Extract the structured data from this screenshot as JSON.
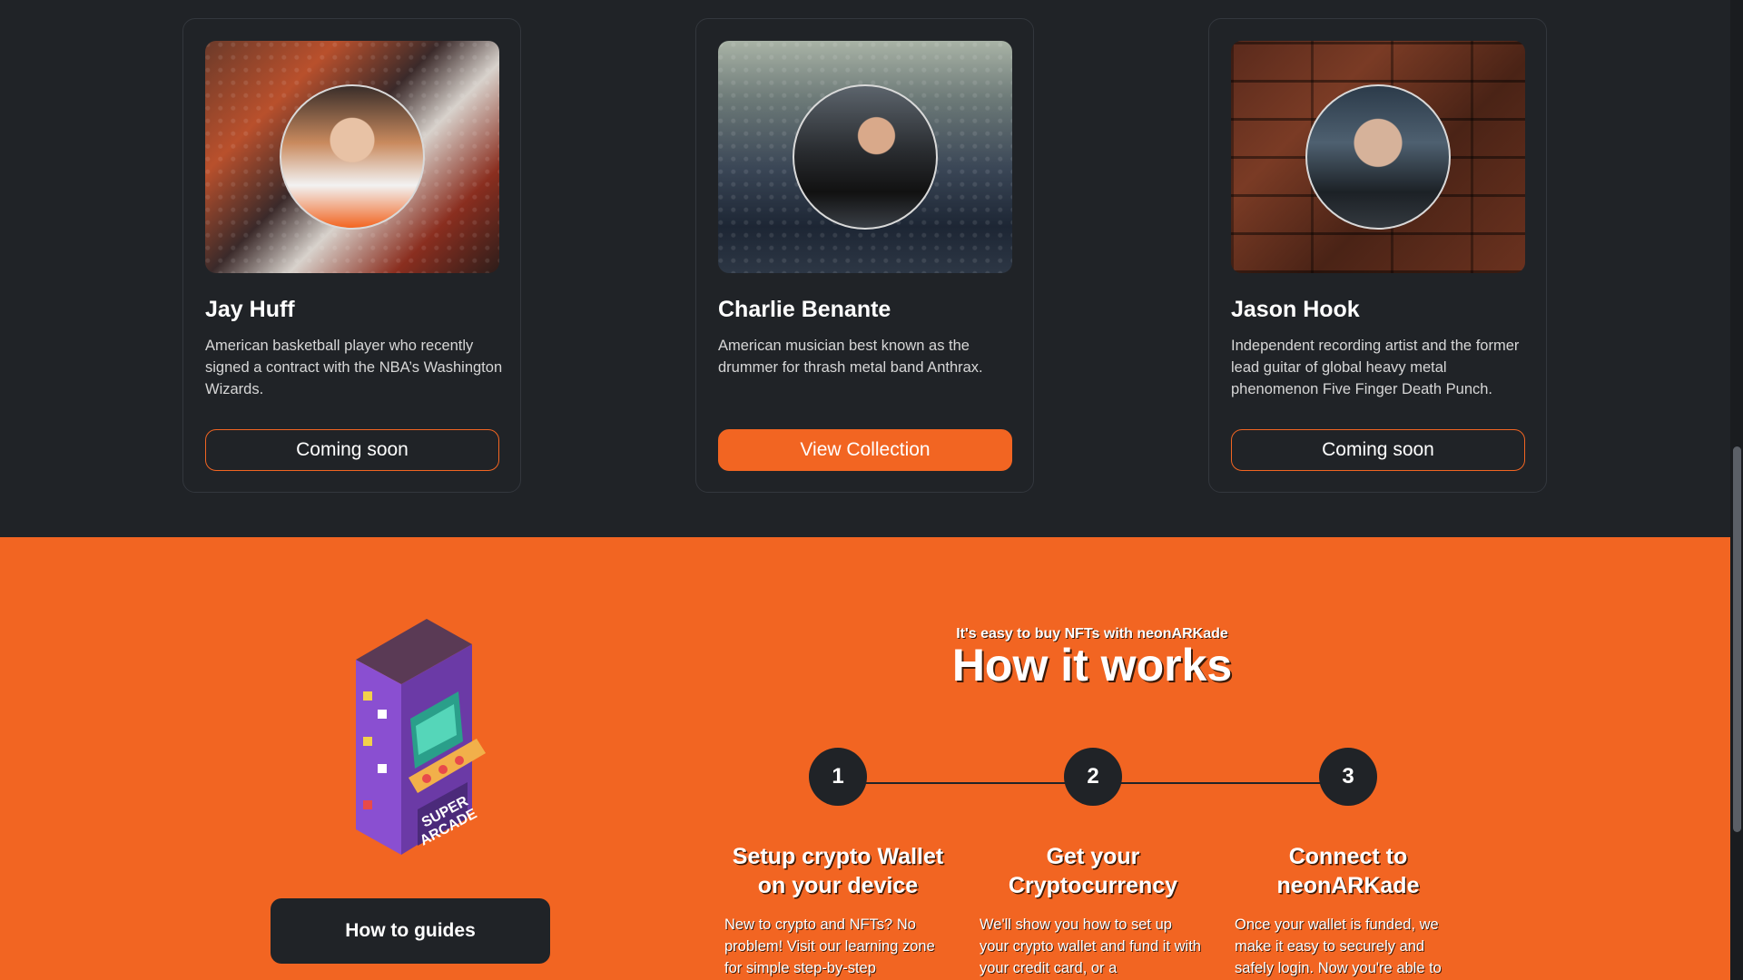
{
  "artists": [
    {
      "name": "Jay Huff",
      "description": "American basketball player who recently signed a contract with the NBA’s Washington Wizards.",
      "button": "Coming soon",
      "button_state": "outline"
    },
    {
      "name": "Charlie Benante",
      "description": "American musician best known as the drummer for thrash metal band Anthrax.",
      "button": "View Collection",
      "button_state": "filled"
    },
    {
      "name": "Jason Hook",
      "description": "Independent recording artist and the former lead guitar of global heavy metal phenomenon Five Finger Death Punch.",
      "button": "Coming soon",
      "button_state": "outline"
    }
  ],
  "how_it_works": {
    "eyebrow": "It's easy to buy NFTs with neonARKade",
    "title": "How it works",
    "guides_button": "How to guides",
    "steps": [
      {
        "number": "1",
        "title": "Setup crypto Wallet on your device",
        "text": "New to crypto and NFTs? No problem! Visit our learning zone for simple step-by-step"
      },
      {
        "number": "2",
        "title": "Get your Cryptocurrency",
        "text": "We'll show you how to set up your crypto wallet and fund it with your credit card, or a"
      },
      {
        "number": "3",
        "title": "Connect to neonARKade",
        "text": "Once your wallet is funded, we make it easy to securely and safely login. Now you're able to"
      }
    ]
  },
  "colors": {
    "accent": "#f26522",
    "dark": "#202327"
  }
}
